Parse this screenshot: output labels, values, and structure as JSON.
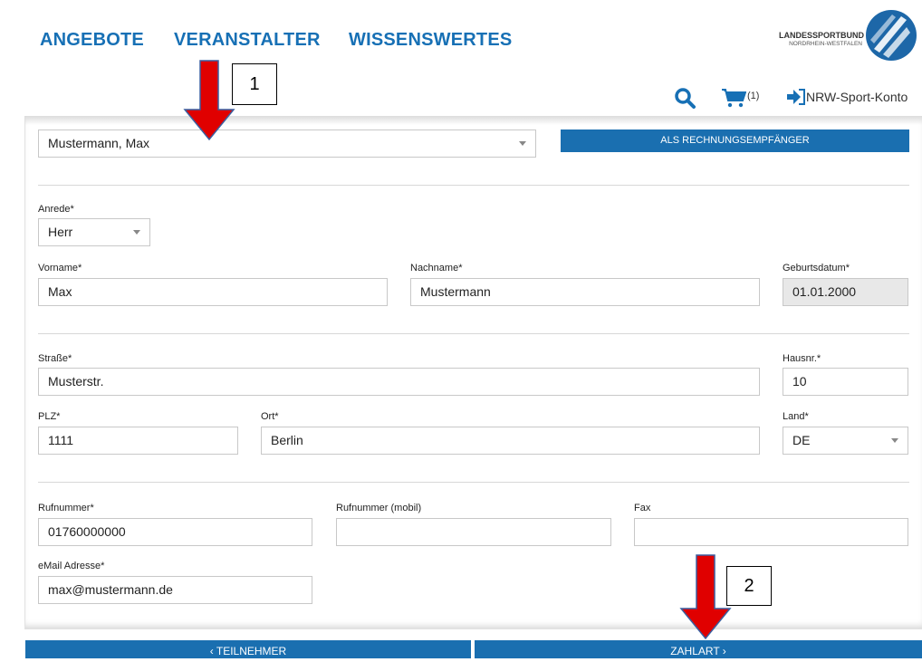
{
  "nav": {
    "items": [
      "ANGEBOTE",
      "VERANSTALTER",
      "WISSENSWERTES"
    ]
  },
  "logo": {
    "line1": "LANDESSPORTBUND",
    "line2": "NORDRHEIN-WESTFALEN"
  },
  "header": {
    "cart_count": "(1)",
    "account_label": "NRW-Sport-Konto"
  },
  "annotations": {
    "callout1": "1",
    "callout2": "2"
  },
  "person_select": {
    "value": "Mustermann, Max"
  },
  "recipient_button": {
    "label": "ALS RECHNUNGSEMPFÄNGER"
  },
  "form": {
    "anrede": {
      "label": "Anrede*",
      "value": "Herr"
    },
    "vorname": {
      "label": "Vorname*",
      "value": "Max"
    },
    "nachname": {
      "label": "Nachname*",
      "value": "Mustermann"
    },
    "geburtsdatum": {
      "label": "Geburtsdatum*",
      "value": "01.01.2000"
    },
    "strasse": {
      "label": "Straße*",
      "value": "Musterstr."
    },
    "hausnr": {
      "label": "Hausnr.*",
      "value": "10"
    },
    "plz": {
      "label": "PLZ*",
      "value": "1111"
    },
    "ort": {
      "label": "Ort*",
      "value": "Berlin"
    },
    "land": {
      "label": "Land*",
      "value": "DE"
    },
    "rufnummer": {
      "label": "Rufnummer*",
      "value": "01760000000"
    },
    "mobil": {
      "label": "Rufnummer (mobil)",
      "value": ""
    },
    "fax": {
      "label": "Fax",
      "value": ""
    },
    "email": {
      "label": "eMail Adresse*",
      "value": "max@mustermann.de"
    }
  },
  "footer": {
    "back_label": "‹ TEILNEHMER",
    "next_label": "ZAHLART ›"
  },
  "colors": {
    "brand_blue": "#1770b5",
    "button_blue": "#1a6fb0",
    "arrow_red": "#e00000"
  }
}
